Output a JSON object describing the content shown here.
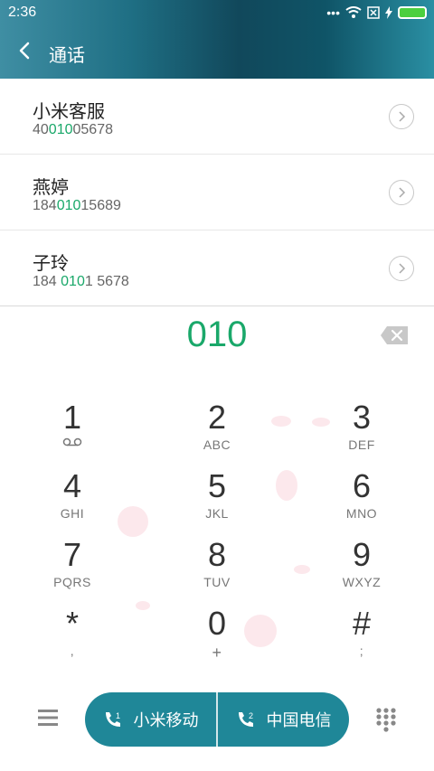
{
  "status_bar": {
    "time": "2:36"
  },
  "header": {
    "title": "通话"
  },
  "results": [
    {
      "name": "小米客服",
      "number_pre": "40",
      "number_hl": "010",
      "number_post": "05678"
    },
    {
      "name": "燕婷",
      "number_pre": "184",
      "number_hl": "010",
      "number_post": "15689"
    },
    {
      "name": "子玲",
      "number_pre": "184 ",
      "number_hl": "010",
      "number_post": "1 5678"
    }
  ],
  "input": {
    "digits": "010"
  },
  "keypad": [
    {
      "num": "1",
      "letters": ""
    },
    {
      "num": "2",
      "letters": "ABC"
    },
    {
      "num": "3",
      "letters": "DEF"
    },
    {
      "num": "4",
      "letters": "GHI"
    },
    {
      "num": "5",
      "letters": "JKL"
    },
    {
      "num": "6",
      "letters": "MNO"
    },
    {
      "num": "7",
      "letters": "PQRS"
    },
    {
      "num": "8",
      "letters": "TUV"
    },
    {
      "num": "9",
      "letters": "WXYZ"
    },
    {
      "num": "*",
      "letters": ","
    },
    {
      "num": "0",
      "letters": "+"
    },
    {
      "num": "#",
      "letters": ";"
    }
  ],
  "sims": [
    {
      "label": "小米移动",
      "slot": "1"
    },
    {
      "label": "中国电信",
      "slot": "2"
    }
  ],
  "colors": {
    "accent": "#1aa86a",
    "sim_button": "#1f8798",
    "header_dark": "#11485b"
  }
}
